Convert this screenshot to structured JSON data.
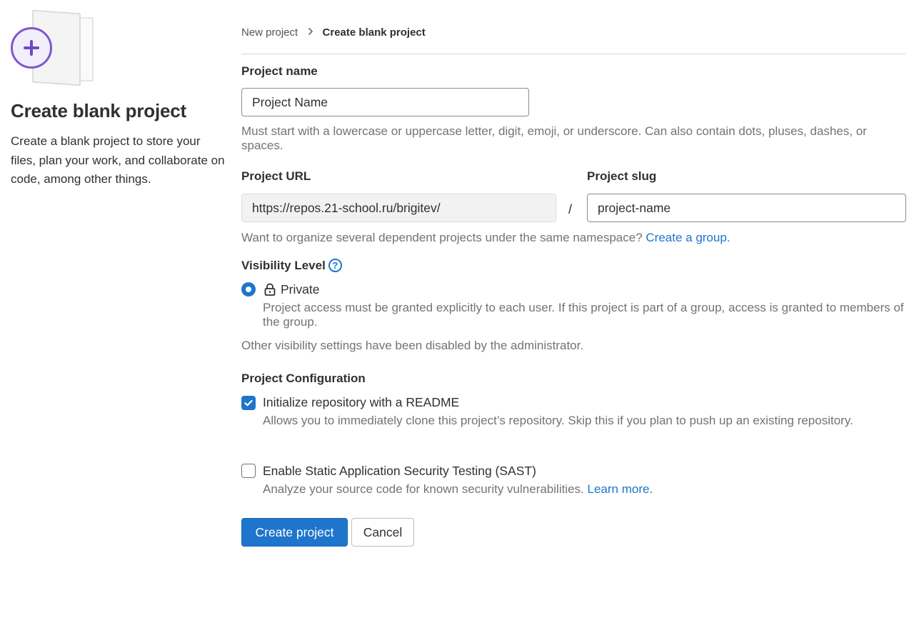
{
  "sidebar": {
    "title": "Create blank project",
    "description": "Create a blank project to store your files, plan your work, and collaborate on code, among other things."
  },
  "breadcrumb": {
    "parent": "New project",
    "current": "Create blank project"
  },
  "form": {
    "project_name": {
      "label": "Project name",
      "value": "Project Name",
      "help": "Must start with a lowercase or uppercase letter, digit, emoji, or underscore. Can also contain dots, pluses, dashes, or spaces."
    },
    "project_url": {
      "label": "Project URL",
      "value": "https://repos.21-school.ru/brigitev/",
      "separator": "/"
    },
    "project_slug": {
      "label": "Project slug",
      "value": "project-name"
    },
    "group_hint": {
      "text": "Want to organize several dependent projects under the same namespace?",
      "link": "Create a group."
    },
    "visibility": {
      "label": "Visibility Level",
      "help_icon": "question-circle-icon",
      "option_label": "Private",
      "option_icon": "lock-icon",
      "option_description": "Project access must be granted explicitly to each user. If this project is part of a group, access is granted to members of the group.",
      "selected": true,
      "disabled_note": "Other visibility settings have been disabled by the administrator."
    },
    "configuration": {
      "label": "Project Configuration",
      "readme": {
        "label": "Initialize repository with a README",
        "description": "Allows you to immediately clone this project’s repository. Skip this if you plan to push up an existing repository.",
        "checked": true
      },
      "sast": {
        "label": "Enable Static Application Security Testing (SAST)",
        "description": "Analyze your source code for known security vulnerabilities.",
        "link": "Learn more.",
        "checked": false
      }
    },
    "buttons": {
      "create": "Create project",
      "cancel": "Cancel"
    }
  },
  "colors": {
    "accent": "#1f75cb",
    "illustration_purple": "#7b58cf",
    "muted_text": "#737373"
  }
}
